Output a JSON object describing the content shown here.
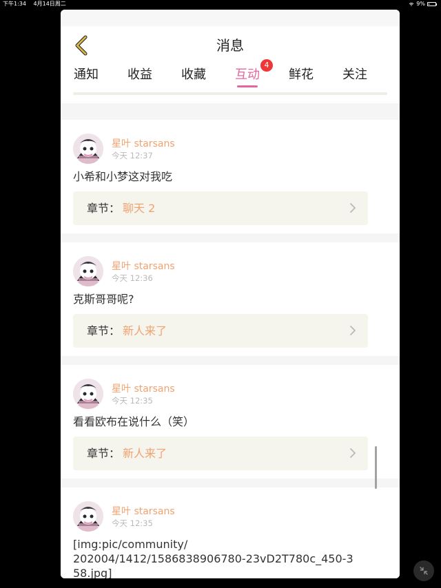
{
  "status_bar": {
    "time": "下午1:34",
    "date": "4月14日周二",
    "battery": "9%"
  },
  "header": {
    "title": "消息",
    "back_icon": "chevron-left-icon"
  },
  "tabs": [
    {
      "label": "通知",
      "active": false
    },
    {
      "label": "收益",
      "active": false
    },
    {
      "label": "收藏",
      "active": false
    },
    {
      "label": "互动",
      "active": true,
      "badge": "4"
    },
    {
      "label": "鲜花",
      "active": false
    },
    {
      "label": "关注",
      "active": false
    }
  ],
  "messages": [
    {
      "user": "星叶 starsans",
      "time": "今天 12:37",
      "text": "小希和小梦这对我吃",
      "chapter_prefix": "章节：",
      "chapter_name": "聊天 2"
    },
    {
      "user": "星叶 starsans",
      "time": "今天 12:36",
      "text": "克斯哥哥呢?",
      "chapter_prefix": "章节：",
      "chapter_name": "新人来了"
    },
    {
      "user": "星叶 starsans",
      "time": "今天 12:35",
      "text": "看看欧布在说什么（笑）",
      "chapter_prefix": "章节：",
      "chapter_name": "新人来了"
    },
    {
      "user": "星叶 starsans",
      "time": "今天 12:35",
      "text": "[img:pic/community/202004/1412/1586838906780-23vD2T780c_450-358.jpg]",
      "text_lines": [
        "[img:pic/community/",
        "202004/1412/1586838906780-23vD2T780c_450-3",
        "58.jpg]"
      ]
    }
  ],
  "colors": {
    "accent": "#e6659c",
    "chapter_text": "#f0a26f",
    "badge": "#ee3737",
    "back_icon": "#d7b64e"
  }
}
